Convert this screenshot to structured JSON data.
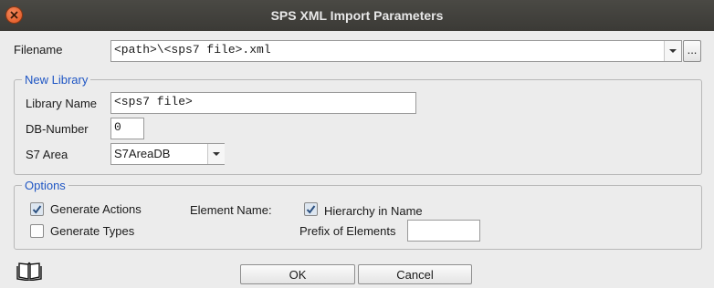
{
  "window": {
    "title": "SPS XML Import Parameters"
  },
  "filename": {
    "label": "Filename",
    "value": "<path>\\<sps7 file>.xml",
    "browse_label": "..."
  },
  "library": {
    "legend": "New Library",
    "name_label": "Library Name",
    "name_value": "<sps7 file>",
    "db_label": "DB-Number",
    "db_value": "0",
    "area_label": "S7 Area",
    "area_value": "S7AreaDB"
  },
  "options": {
    "legend": "Options",
    "generate_actions": {
      "label": "Generate Actions",
      "checked": true
    },
    "generate_types": {
      "label": "Generate Types",
      "checked": false
    },
    "element_name_label": "Element Name:",
    "hierarchy_in_name": {
      "label": "Hierarchy in Name",
      "checked": true
    },
    "prefix_label": "Prefix of Elements",
    "prefix_value": ""
  },
  "footer": {
    "help_icon": "book-icon",
    "ok_label": "OK",
    "cancel_label": "Cancel"
  },
  "colors": {
    "accent": "#1f56c4",
    "titlebar": "#3f3e3a",
    "close": "#e0521c"
  }
}
